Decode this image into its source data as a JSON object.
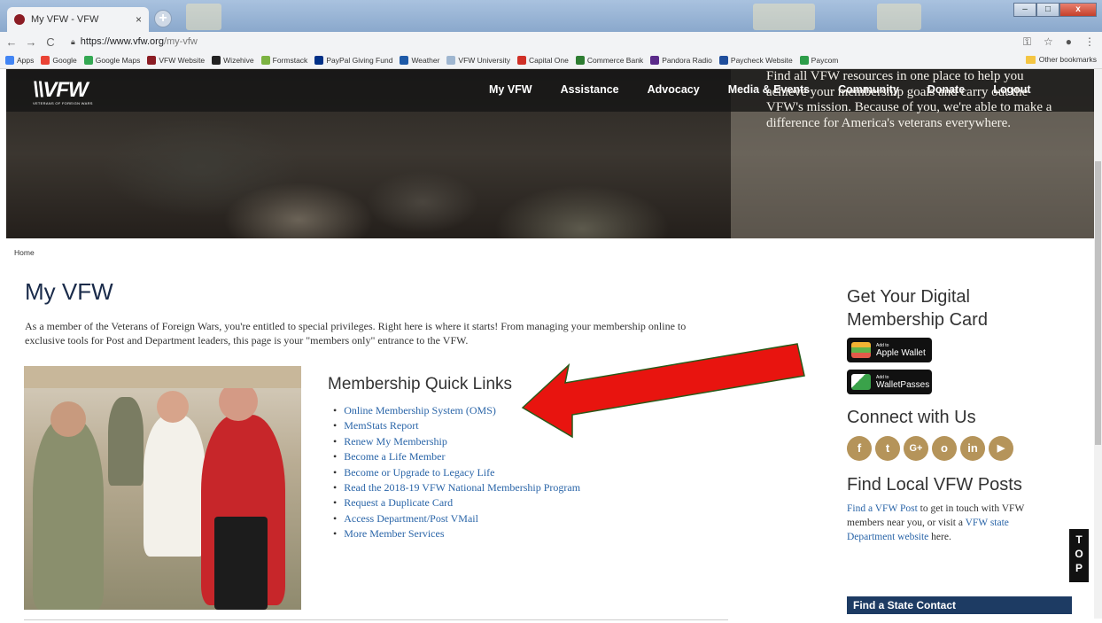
{
  "browser": {
    "tab_title": "My VFW - VFW",
    "tab_close": "×",
    "new_tab": "+",
    "win_minimize": "–",
    "win_maximize": "□",
    "win_close": "x",
    "url_host": "https://www.vfw.org",
    "url_path": "/my-vfw",
    "bookmarks": [
      {
        "label": "Apps",
        "color": "#4285f4"
      },
      {
        "label": "Google",
        "color": "#ea4335"
      },
      {
        "label": "Google Maps",
        "color": "#34a853"
      },
      {
        "label": "VFW Website",
        "color": "#8b1c24"
      },
      {
        "label": "Wizehive",
        "color": "#222222"
      },
      {
        "label": "Formstack",
        "color": "#7cb342"
      },
      {
        "label": "PayPal Giving Fund",
        "color": "#003087"
      },
      {
        "label": "Weather",
        "color": "#1e5aa8"
      },
      {
        "label": "VFW University",
        "color": "#9fb6d0"
      },
      {
        "label": "Capital One",
        "color": "#d03027"
      },
      {
        "label": "Commerce Bank",
        "color": "#2e7d32"
      },
      {
        "label": "Pandora Radio",
        "color": "#5b2b8a"
      },
      {
        "label": "Paycheck Website",
        "color": "#1f4e9c"
      },
      {
        "label": "Paycom",
        "color": "#2e9d4a"
      }
    ],
    "other_bookmarks": "Other bookmarks"
  },
  "site": {
    "logo_word": "\\\\VFW",
    "logo_sub": "VETERANS OF FOREIGN WARS",
    "nav": [
      "My VFW",
      "Assistance",
      "Advocacy",
      "Media & Events",
      "Community",
      "Donate",
      "Logout"
    ],
    "hero_text": "Find all VFW resources in one place to help you achieve your membership goals and carry out the VFW's mission. Because of you, we're able to make a difference for America's veterans everywhere."
  },
  "main": {
    "breadcrumb": "Home",
    "title": "My VFW",
    "intro": "As a member of the Veterans of Foreign Wars, you're entitled to special privileges. Right here is where it starts! From managing your membership online to exclusive tools for Post and Department leaders, this page is your \"members only\" entrance to the VFW.",
    "quick_links_title": "Membership Quick Links",
    "quick_links": [
      "Online Membership System (OMS)",
      "MemStats Report",
      "Renew My Membership",
      "Become a Life Member",
      "Become or Upgrade to Legacy Life",
      "Read the 2018-19 VFW National Membership Program",
      "Request a Duplicate Card",
      "Access Department/Post VMail",
      "More Member Services"
    ]
  },
  "sidebar": {
    "digital_card_title": "Get Your Digital Membership Card",
    "apple_wallet_small": "Add to",
    "apple_wallet": "Apple Wallet",
    "walletpasses_small": "Add to",
    "walletpasses": "WalletPasses",
    "connect_title": "Connect with Us",
    "social": [
      "f",
      "t",
      "G+",
      "o",
      "in",
      "▶"
    ],
    "local_title": "Find Local VFW Posts",
    "local_link1": "Find a VFW Post",
    "local_text1": " to get in touch with VFW members near you, or visit a ",
    "local_link2": "VFW state Department website",
    "local_text2": " here.",
    "state_contact": "Find a State Contact",
    "top_letters": [
      "T",
      "O",
      "P"
    ]
  },
  "colors": {
    "arrow_fill": "#e8140f",
    "link": "#2a65a8",
    "state_bar": "#1d3b63"
  }
}
